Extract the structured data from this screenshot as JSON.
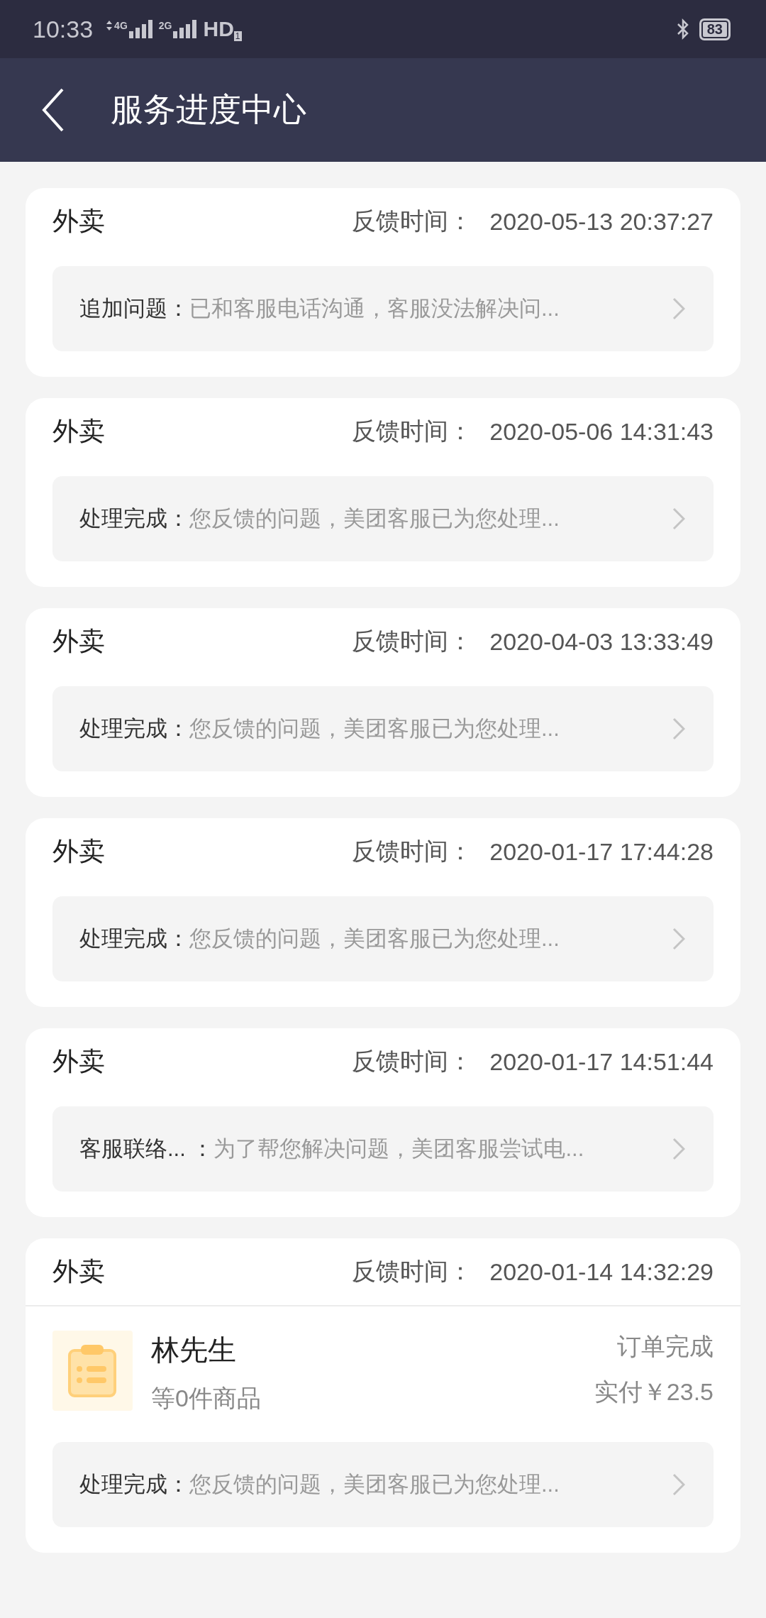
{
  "status_bar": {
    "time": "10:33",
    "network_1": "4G",
    "network_2": "2G",
    "hd": "HD",
    "hd_sub": "1",
    "battery": "83"
  },
  "header": {
    "title": "服务进度中心"
  },
  "cards": [
    {
      "category": "外卖",
      "time_label": "反馈时间：",
      "time": "2020-05-13 20:37:27",
      "status": "追加问题：",
      "message": "已和客服电话沟通，客服没法解决问..."
    },
    {
      "category": "外卖",
      "time_label": "反馈时间：",
      "time": "2020-05-06 14:31:43",
      "status": "处理完成：",
      "message": "您反馈的问题，美团客服已为您处理..."
    },
    {
      "category": "外卖",
      "time_label": "反馈时间：",
      "time": "2020-04-03 13:33:49",
      "status": "处理完成：",
      "message": "您反馈的问题，美团客服已为您处理..."
    },
    {
      "category": "外卖",
      "time_label": "反馈时间：",
      "time": "2020-01-17 17:44:28",
      "status": "处理完成：",
      "message": "您反馈的问题，美团客服已为您处理..."
    },
    {
      "category": "外卖",
      "time_label": "反馈时间：",
      "time": "2020-01-17 14:51:44",
      "status": "客服联络... ：",
      "message": "为了帮您解决问题，美团客服尝试电..."
    },
    {
      "category": "外卖",
      "time_label": "反馈时间：",
      "time": "2020-01-14 14:32:29",
      "order": {
        "name": "林先生",
        "items": "等0件商品",
        "state": "订单完成",
        "paid": "实付￥23.5"
      },
      "status": "处理完成：",
      "message": "您反馈的问题，美团客服已为您处理..."
    }
  ]
}
